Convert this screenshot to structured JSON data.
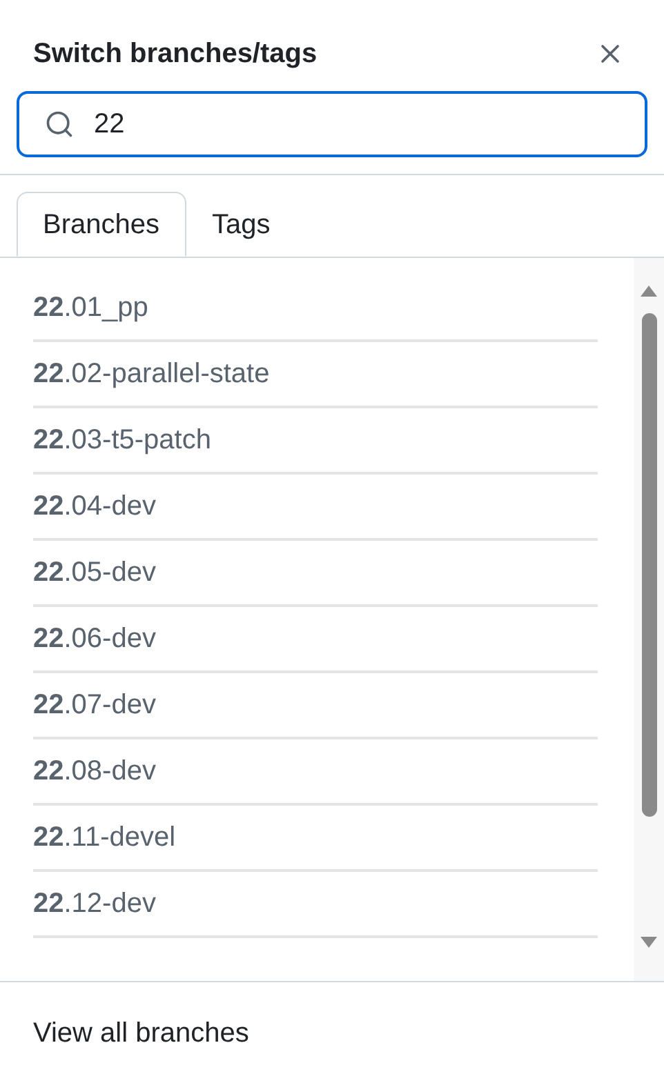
{
  "dialog": {
    "title": "Switch branches/tags"
  },
  "search": {
    "value": "22"
  },
  "tabs": [
    {
      "label": "Branches",
      "selected": true
    },
    {
      "label": "Tags",
      "selected": false
    }
  ],
  "branches": [
    "**22**.01_pp",
    "**22**.02-parallel-state",
    "**22**.03-t5-patch",
    "**22**.04-dev",
    "**22**.05-dev",
    "**22**.06-dev",
    "**22**.07-dev",
    "**22**.08-dev",
    "**22**.11-devel",
    "**22**.12-dev"
  ],
  "footer_link": "View all branches"
}
